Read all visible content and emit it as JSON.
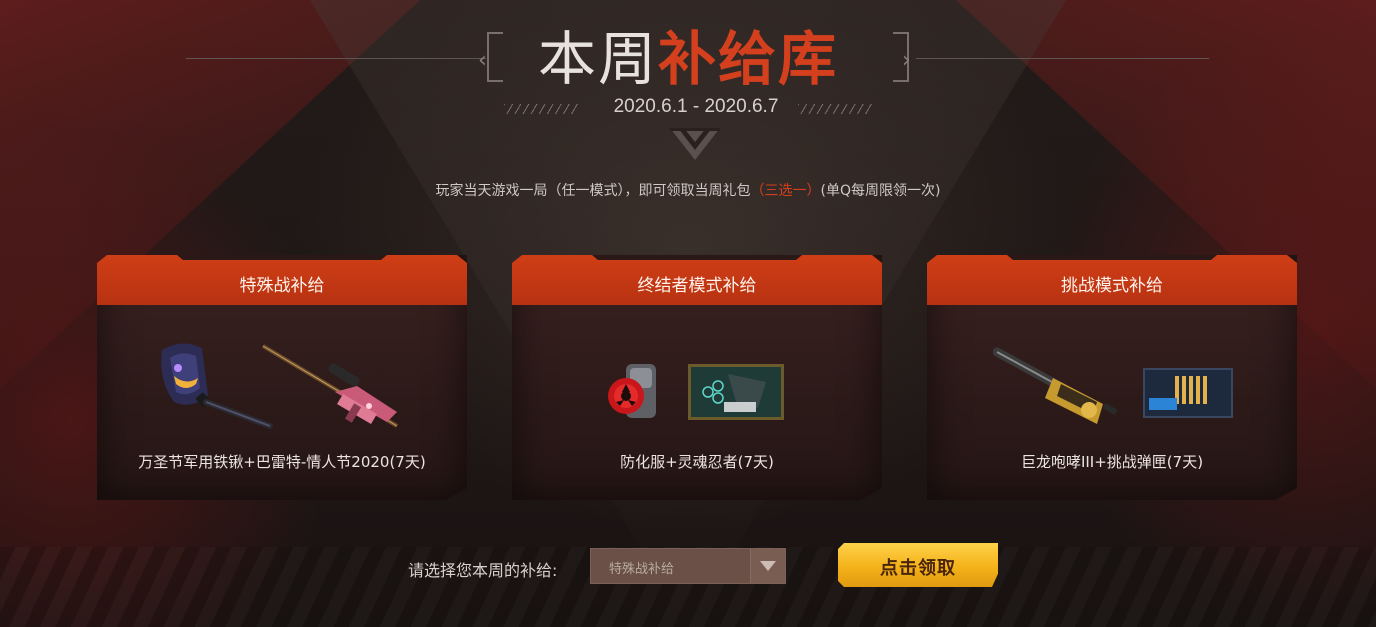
{
  "header": {
    "title_part1": "本周",
    "title_part2": "补给库",
    "date_range": "2020.6.1 - 2020.6.7"
  },
  "notice": {
    "text_before": "玩家当天游戏一局（任一模式），即可领取当周礼包",
    "text_accent": "（三选一）",
    "text_after": "(单Q每周限领一次)"
  },
  "cards": [
    {
      "title": "特殊战补给",
      "description": "万圣节军用铁锹+巴雷特-情人节2020(7天)",
      "item_icons": [
        "halloween-shovel-icon",
        "barrett-sniper-rifle-icon"
      ]
    },
    {
      "title": "终结者模式补给",
      "description": "防化服+灵魂忍者(7天)",
      "item_icons": [
        "hazmat-suit-icon",
        "soul-ninja-card-icon"
      ]
    },
    {
      "title": "挑战模式补给",
      "description": "巨龙咆哮III+挑战弹匣(7天)",
      "item_icons": [
        "dragon-roar-gatling-icon",
        "challenge-magazine-icon"
      ]
    }
  ],
  "footer": {
    "select_label": "请选择您本周的补给:",
    "select_value": "特殊战补给",
    "claim_button_label": "点击领取"
  },
  "colors": {
    "accent_red": "#d4401d",
    "card_header": "#c9391a",
    "button_gold": "#f3b219"
  }
}
